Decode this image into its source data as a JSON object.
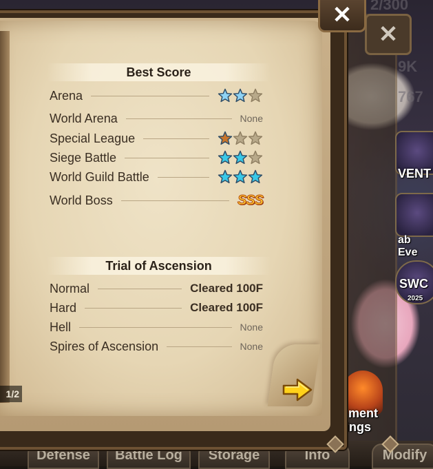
{
  "background": {
    "top_number": "2/300",
    "numbers": [
      "9K",
      "767"
    ],
    "side_labels": [
      "VENT",
      "ab Eve",
      "SWC",
      "2025",
      "ement",
      "tings"
    ],
    "bottom_tabs": [
      "Defense",
      "Battle Log",
      "Storage",
      "Info",
      "Modify"
    ],
    "ghost_close_label": "✕"
  },
  "book": {
    "close_label": "✕",
    "pager": "1/2",
    "best_score": {
      "title": "Best Score",
      "rows": [
        {
          "label": "Arena",
          "value_type": "stars",
          "stars": [
            "blue",
            "blue",
            "empty"
          ]
        },
        {
          "label": "World Arena",
          "value_type": "text",
          "value": "None"
        },
        {
          "label": "Special League",
          "value_type": "stars",
          "stars": [
            "bronze",
            "empty",
            "empty"
          ]
        },
        {
          "label": "Siege Battle",
          "value_type": "stars",
          "stars": [
            "cyan",
            "cyan",
            "empty"
          ]
        },
        {
          "label": "World Guild Battle",
          "value_type": "stars",
          "stars": [
            "cyan",
            "cyan",
            "cyan"
          ]
        },
        {
          "label": "World Boss",
          "value_type": "rank",
          "value": "SSS"
        }
      ]
    },
    "trial": {
      "title": "Trial of Ascension",
      "rows": [
        {
          "label": "Normal",
          "value": "Cleared 100F",
          "bold": true
        },
        {
          "label": "Hard",
          "value": "Cleared 100F",
          "bold": true
        },
        {
          "label": "Hell",
          "value": "None",
          "bold": false
        },
        {
          "label": "Spires of Ascension",
          "value": "None",
          "bold": false
        }
      ]
    }
  },
  "colors": {
    "star_blue": "#8fd3f5",
    "star_cyan": "#39c9e8",
    "star_bronze": "#c8742a",
    "star_empty": "#b8a98a",
    "rank_gold": "#ffcc33",
    "arrow_yellow": "#ffd21a"
  }
}
